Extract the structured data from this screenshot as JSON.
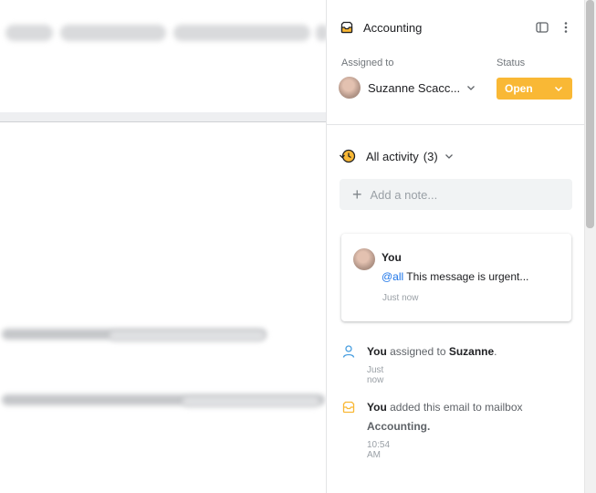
{
  "panel": {
    "mailbox_title": "Accounting",
    "assigned_to_label": "Assigned to",
    "assignee_name": "Suzanne Scacc...",
    "status_label": "Status",
    "status_value": "Open",
    "activity_label": "All activity",
    "activity_count": "(3)",
    "note_placeholder": "Add a note..."
  },
  "comment": {
    "author": "You",
    "mention": "@all",
    "text": " This message is urgent...",
    "time": "Just now"
  },
  "events": [
    {
      "actor": "You",
      "action": " assigned to ",
      "target": "Suzanne",
      "suffix": ".",
      "time": "Just now"
    },
    {
      "actor": "You",
      "action": " added this email to mailbox",
      "target": "Accounting.",
      "time": "10:54 AM"
    }
  ],
  "colors": {
    "status_accent": "#f9b835",
    "mention_blue": "#1a73e8",
    "mailbox_icon": "#f9b835",
    "person_icon": "#4a9fe0"
  },
  "icons": {
    "mailbox": "inbox-icon",
    "sidebar_toggle": "panel-toggle-icon",
    "more": "more-vert-icon",
    "history": "history-clock-icon",
    "person": "person-icon"
  }
}
